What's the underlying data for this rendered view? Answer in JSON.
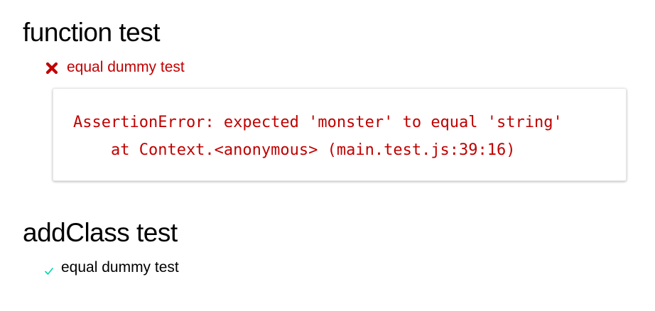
{
  "suites": [
    {
      "title": "function test",
      "tests": [
        {
          "status": "fail",
          "icon": "fail-x-icon",
          "label": "equal dummy test",
          "error": {
            "message": "AssertionError: expected 'monster' to equal 'string'",
            "stack": "    at Context.<anonymous> (main.test.js:39:16)"
          }
        }
      ]
    },
    {
      "title": "addClass test",
      "tests": [
        {
          "status": "pass",
          "icon": "pass-check-icon",
          "label": "equal dummy test"
        }
      ]
    }
  ],
  "colors": {
    "fail": "#c00000",
    "pass": "#00d6b2",
    "text": "#000000"
  }
}
